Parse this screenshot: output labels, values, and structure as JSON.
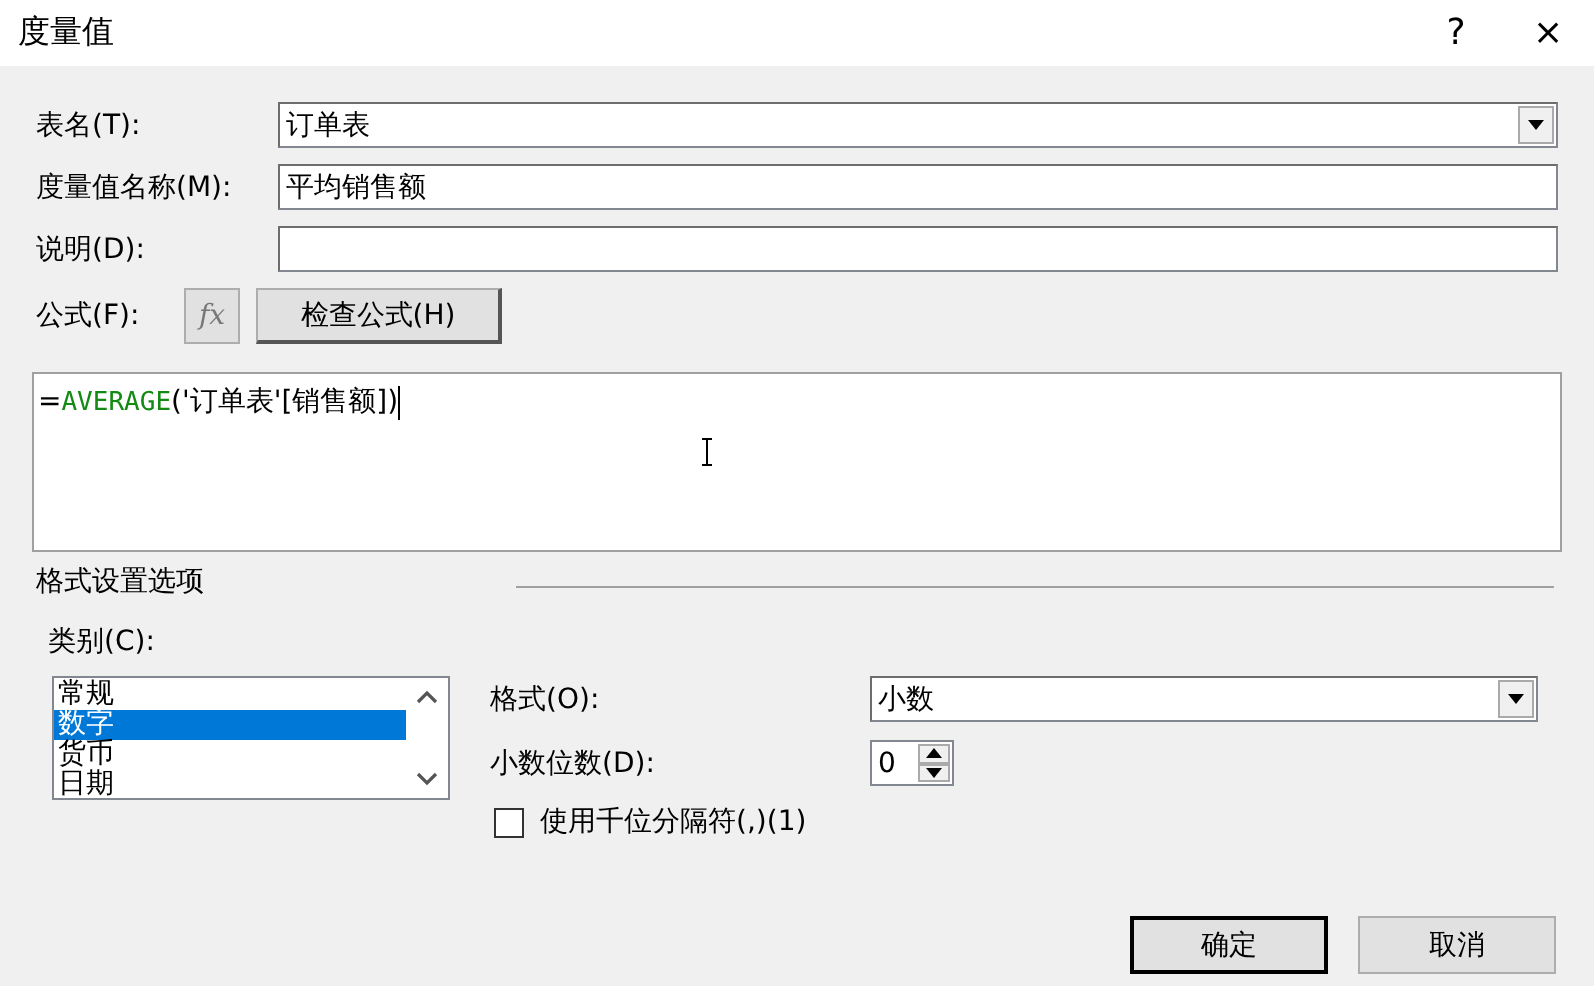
{
  "window": {
    "title": "度量值",
    "help": "?",
    "close": "×"
  },
  "fields": [
    {
      "label": "表名(T):",
      "kind": "dropdown",
      "value": "订单表"
    },
    {
      "label": "度量值名称(M):",
      "kind": "text",
      "value": "平均销售额"
    },
    {
      "label": "说明(D):",
      "kind": "text"
    }
  ],
  "formula": {
    "label": "公式(F):",
    "fx": "fx",
    "check_button": "检查公式(H)",
    "parts": [
      {
        "text": "=",
        "kind": "plain"
      },
      {
        "text": "AVERAGE",
        "kind": "function"
      },
      {
        "text": "('订单表'[销售额])",
        "kind": "plain"
      }
    ]
  },
  "format_section": {
    "title": "格式设置选项",
    "category_label": "类别(C):",
    "categories": [
      {
        "label": "常规",
        "selected": false
      },
      {
        "label": "数字",
        "selected": true
      },
      {
        "label": "货币",
        "selected": false
      },
      {
        "label": "日期",
        "selected": false
      }
    ],
    "format_label": "格式(O):",
    "format_value": "小数",
    "decimals_label": "小数位数(D):",
    "decimals_value": "0",
    "thousands": {
      "label": "使用千位分隔符(,)(1)",
      "checked": false
    }
  },
  "buttons": [
    "确定",
    "取消"
  ]
}
